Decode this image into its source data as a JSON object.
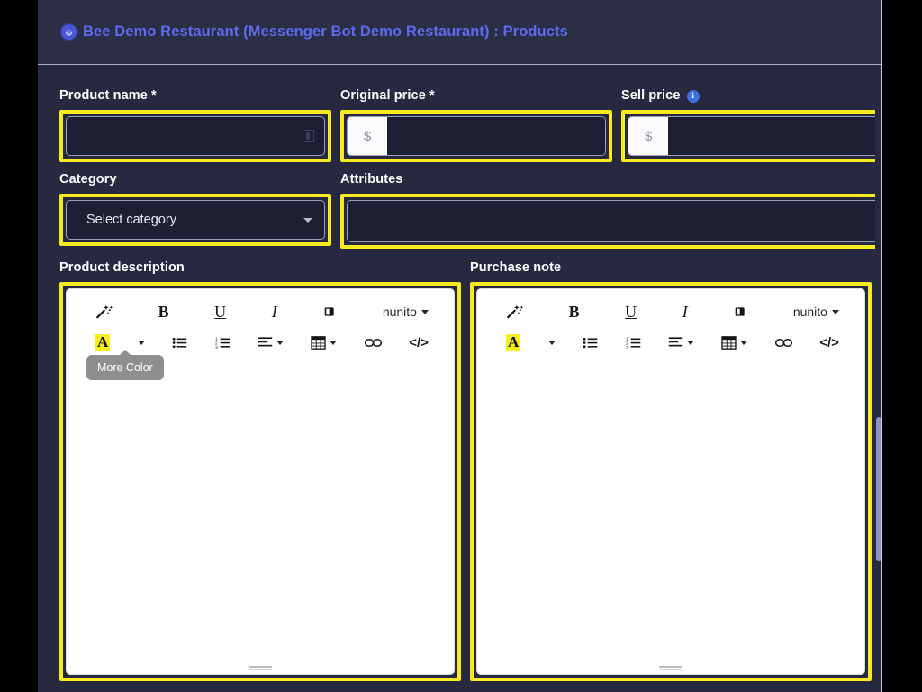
{
  "header": {
    "brand_icon": "bee-badge-icon",
    "title": "Bee Demo Restaurant (Messenger Bot Demo Restaurant) : Products"
  },
  "colors": {
    "page_bg": "#262940",
    "letterbox": "#000000",
    "accent_highlight": "#f7ea1e",
    "title_blue": "#5c6bf0",
    "info_blue": "#3d6fe0",
    "tooltip_gray": "#8e8e8e",
    "editor_white": "#ffffff",
    "input_bg": "#1d2034",
    "input_border": "#9ba0b8"
  },
  "form": {
    "product_name": {
      "label": "Product name",
      "required_marker": "*",
      "value": "",
      "placeholder": "",
      "trailing_icon": "swatch-icon"
    },
    "original_price": {
      "label": "Original price",
      "required_marker": "*",
      "currency_symbol": "$",
      "value": "",
      "placeholder": ""
    },
    "sell_price": {
      "label": "Sell price",
      "info_icon": "info-circle-icon",
      "info_glyph": "i",
      "currency_symbol": "$",
      "value": "",
      "placeholder": ""
    },
    "category": {
      "label": "Category",
      "selected": "Select category",
      "options": [
        "Select category"
      ],
      "caret_icon": "chevron-down-icon"
    },
    "attributes": {
      "label": "Attributes",
      "value": "",
      "placeholder": ""
    },
    "product_description": {
      "label": "Product description",
      "content": ""
    },
    "purchase_note": {
      "label": "Purchase note",
      "content": ""
    }
  },
  "editor_toolbar": {
    "row1": [
      {
        "name": "style-magic-wand-icon",
        "glyph": "✨",
        "label": "Style"
      },
      {
        "name": "bold-icon",
        "glyph": "B",
        "label": "Bold"
      },
      {
        "name": "underline-icon",
        "glyph": "U",
        "label": "Underline"
      },
      {
        "name": "italic-icon",
        "glyph": "I",
        "label": "Italic"
      },
      {
        "name": "remove-format-eraser-icon",
        "glyph": "▰",
        "label": "Remove Font Style"
      }
    ],
    "font_family": {
      "name": "font-family-dropdown",
      "value": "nunito",
      "caret_icon": "chevron-down-icon"
    },
    "row2": [
      {
        "name": "font-color-icon",
        "glyph": "A",
        "label": "Font Color"
      },
      {
        "name": "more-color-caret-icon",
        "glyph": "▾",
        "label": "More Color"
      },
      {
        "name": "unordered-list-icon",
        "glyph": "list",
        "label": "Unordered list"
      },
      {
        "name": "ordered-list-icon",
        "glyph": "list-ol",
        "label": "Ordered list"
      },
      {
        "name": "paragraph-align-icon",
        "glyph": "align",
        "label": "Paragraph"
      },
      {
        "name": "table-icon",
        "glyph": "table",
        "label": "Table"
      },
      {
        "name": "link-icon",
        "glyph": "link",
        "label": "Link"
      },
      {
        "name": "code-view-icon",
        "glyph": "</>",
        "label": "Code View"
      }
    ]
  },
  "tooltip": {
    "name": "more-color-tooltip",
    "text": "More Color"
  },
  "editor_resize_handle": {
    "name": "editor-resize-grip",
    "label": "resize"
  },
  "scrollbar": {
    "name": "vertical-scrollbar",
    "thumb_name": "vertical-scrollbar-thumb"
  }
}
